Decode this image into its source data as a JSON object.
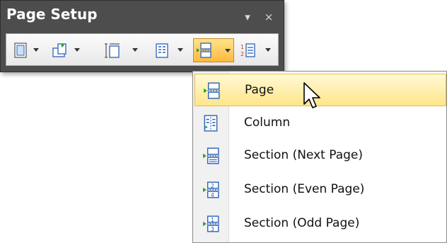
{
  "window": {
    "title": "Page Setup",
    "menu_glyph": "▾",
    "close_glyph": "×"
  },
  "toolbar": {
    "tools": [
      {
        "icon": "margins-icon",
        "has_dropdown": true
      },
      {
        "icon": "orientation-icon",
        "has_dropdown": true
      },
      {
        "icon": "size-icon",
        "has_dropdown": true
      },
      {
        "icon": "columns-icon",
        "has_dropdown": true
      },
      {
        "icon": "breaks-icon",
        "has_dropdown": true,
        "active": true
      },
      {
        "icon": "line-numbers-icon",
        "has_dropdown": true
      }
    ]
  },
  "menu": {
    "items": [
      {
        "label": "Page",
        "icon": "page-break-icon",
        "hover": true
      },
      {
        "label": "Column",
        "icon": "column-break-icon"
      },
      {
        "label": "Section (Next Page)",
        "icon": "section-next-page-icon"
      },
      {
        "label": "Section (Even Page)",
        "icon": "section-even-page-icon"
      },
      {
        "label": "Section (Odd Page)",
        "icon": "section-odd-page-icon"
      }
    ]
  },
  "colors": {
    "window_bg": "#4d4d4d",
    "hover_gradient_top": "#fff9d5",
    "hover_gradient_bottom": "#ffe58a",
    "active_tool": "#ffb93d",
    "icon_blue": "#2b63b8",
    "icon_green": "#1f9a2e"
  }
}
